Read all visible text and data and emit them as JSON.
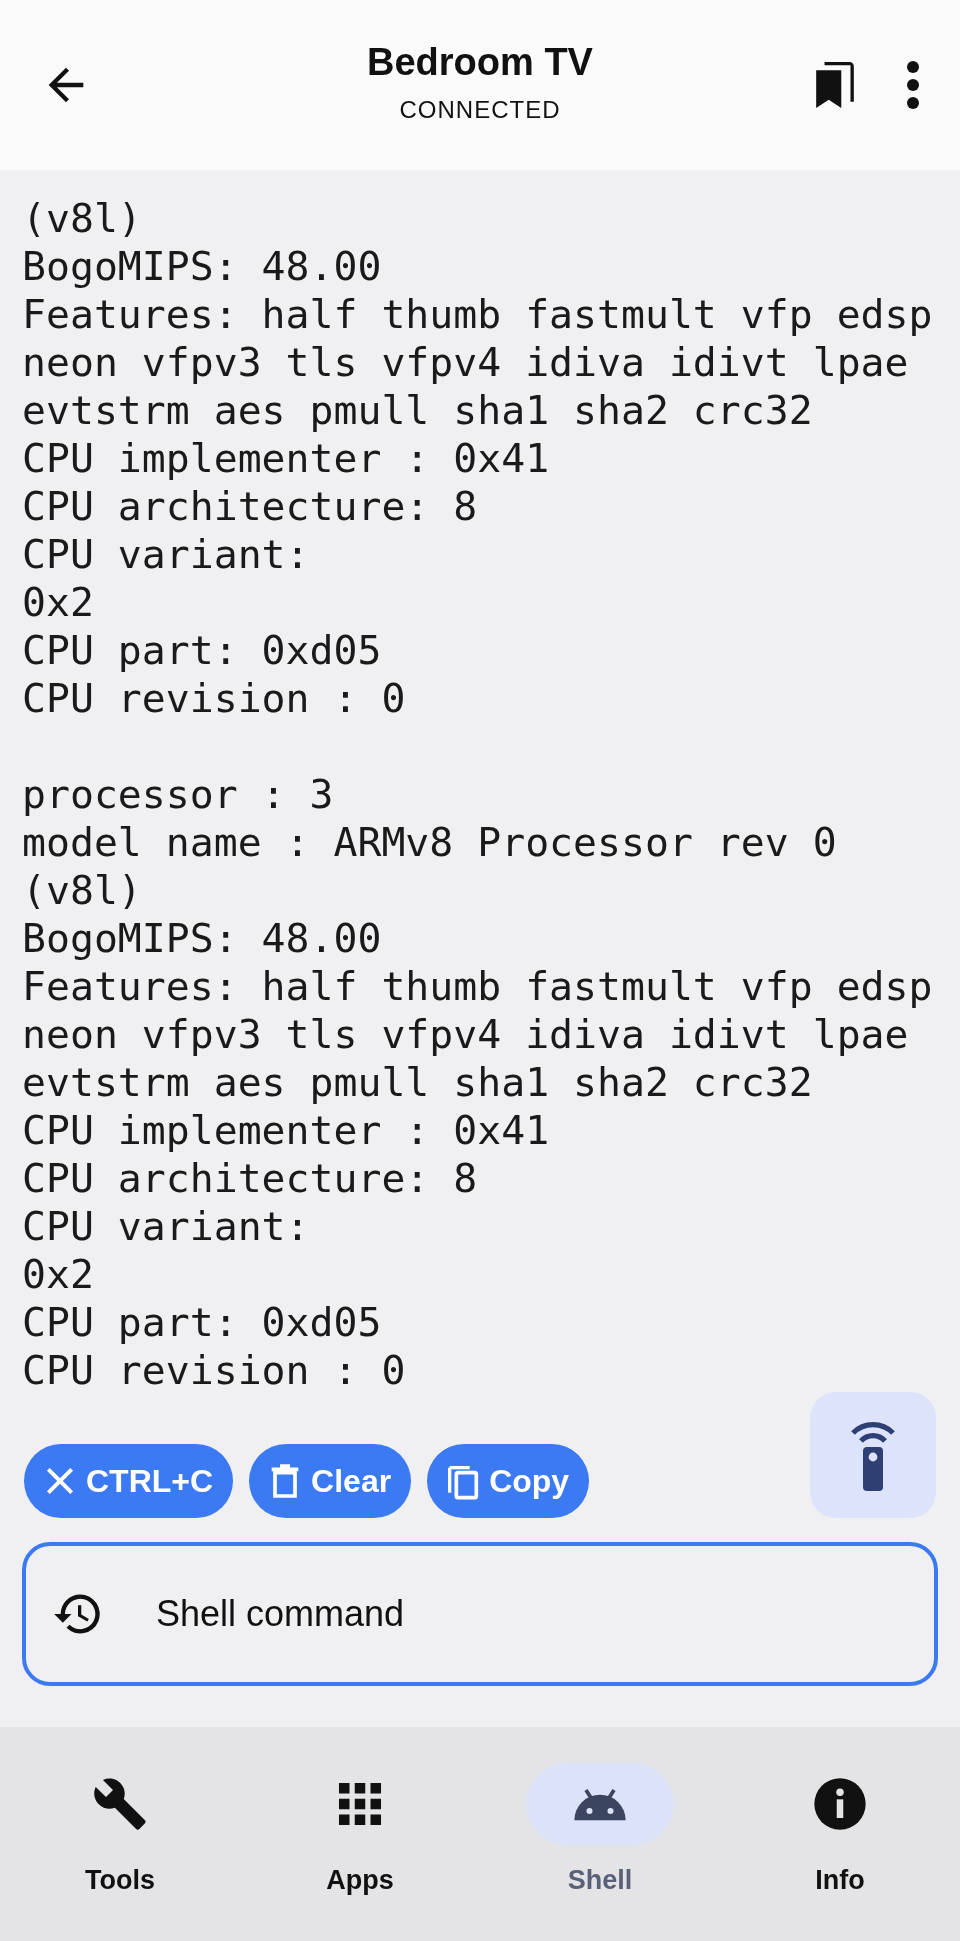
{
  "app_bar": {
    "title": "Bedroom TV",
    "subtitle": "CONNECTED"
  },
  "output_blocks": [
    [
      "(v8l)",
      "BogoMIPS: 48.00",
      "Features: half thumb fastmult vfp edsp",
      "neon vfpv3 tls vfpv4 idiva idivt lpae",
      "evtstrm aes pmull sha1 sha2 crc32",
      "CPU implementer : 0x41",
      "CPU architecture: 8",
      "CPU variant:",
      "0x2",
      "CPU part: 0xd05",
      "CPU revision : 0"
    ],
    [
      "processor : 3",
      "model name : ARMv8 Processor rev 0",
      "(v8l)",
      "BogoMIPS: 48.00",
      "Features: half thumb fastmult vfp edsp",
      "neon vfpv3 tls vfpv4 idiva idivt lpae",
      "evtstrm aes pmull sha1 sha2 crc32",
      "CPU implementer : 0x41",
      "CPU architecture: 8",
      "CPU variant:",
      "0x2",
      "CPU part: 0xd05",
      "CPU revision : 0"
    ]
  ],
  "actions": [
    {
      "kind": "cancel",
      "label": "CTRL+C"
    },
    {
      "kind": "clear",
      "label": "Clear"
    },
    {
      "kind": "copy",
      "label": "Copy"
    }
  ],
  "command_field": {
    "placeholder": "Shell command"
  },
  "nav": [
    {
      "kind": "tools",
      "label": "Tools",
      "selected": false
    },
    {
      "kind": "apps",
      "label": "Apps",
      "selected": false
    },
    {
      "kind": "shell",
      "label": "Shell",
      "selected": true
    },
    {
      "kind": "info",
      "label": "Info",
      "selected": false
    }
  ]
}
